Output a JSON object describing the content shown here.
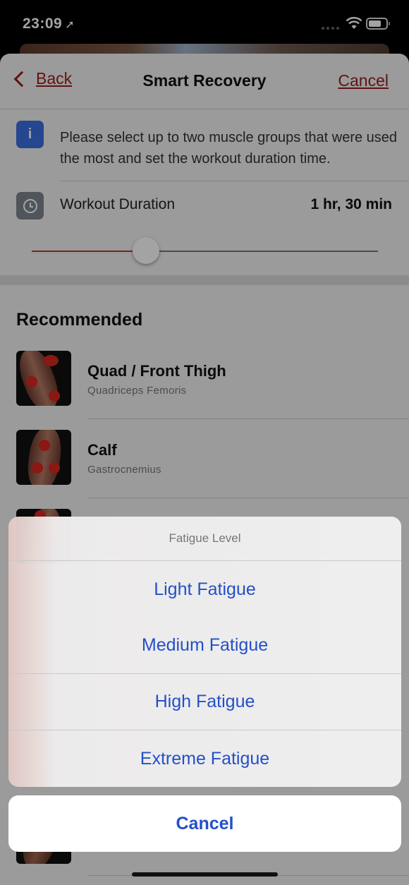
{
  "status": {
    "time": "23:09"
  },
  "nav": {
    "back": "Back",
    "title": "Smart Recovery",
    "cancel": "Cancel"
  },
  "info": {
    "text": "Please select up to two muscle groups that were used the most and set the workout duration time."
  },
  "duration": {
    "label": "Workout Duration",
    "value": "1 hr, 30 min",
    "slider_fraction": 0.33
  },
  "recommended": {
    "title": "Recommended",
    "items": [
      {
        "title": "Quad / Front Thigh",
        "subtitle": "Quadriceps Femoris"
      },
      {
        "title": "Calf",
        "subtitle": "Gastrocnemius"
      }
    ]
  },
  "action_sheet": {
    "title": "Fatigue Level",
    "options": [
      "Light Fatigue",
      "Medium Fatigue",
      "High Fatigue",
      "Extreme Fatigue"
    ],
    "cancel": "Cancel"
  },
  "colors": {
    "accent": "#9b1b1b",
    "action_blue": "#2450c8",
    "info_blue": "#3b6fe0"
  }
}
